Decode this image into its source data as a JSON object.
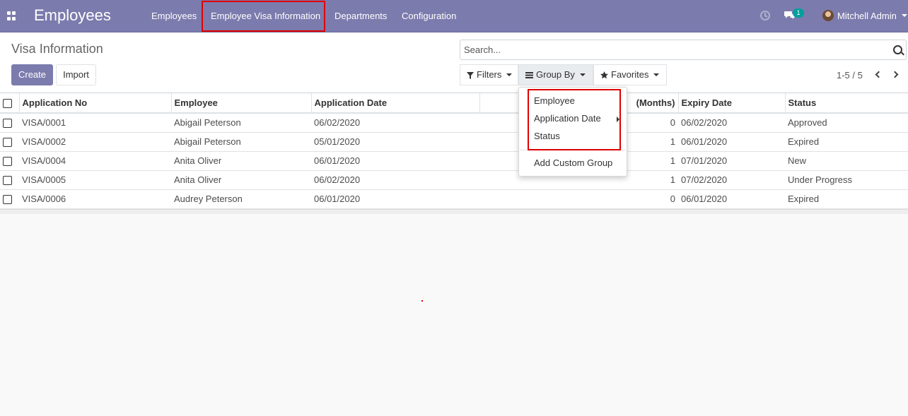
{
  "navbar": {
    "app_title": "Employees",
    "menu": [
      "Employees",
      "Employee Visa Information",
      "Departments",
      "Configuration"
    ],
    "chat_count": "1",
    "user_name": "Mitchell Admin"
  },
  "control_panel": {
    "title": "Visa Information",
    "create_label": "Create",
    "import_label": "Import",
    "search_placeholder": "Search...",
    "filters_label": "Filters",
    "group_by_label": "Group By",
    "favorites_label": "Favorites",
    "pager": "1-5 / 5"
  },
  "table": {
    "columns": [
      "Application No",
      "Employee",
      "Application Date",
      "(Months)",
      "Expiry Date",
      "Status"
    ],
    "rows": [
      {
        "app_no": "VISA/0001",
        "employee": "Abigail Peterson",
        "app_date": "06/02/2020",
        "months": "0",
        "expiry": "06/02/2020",
        "status": "Approved"
      },
      {
        "app_no": "VISA/0002",
        "employee": "Abigail Peterson",
        "app_date": "05/01/2020",
        "months": "1",
        "expiry": "06/01/2020",
        "status": "Expired"
      },
      {
        "app_no": "VISA/0004",
        "employee": "Anita Oliver",
        "app_date": "06/01/2020",
        "months": "1",
        "expiry": "07/01/2020",
        "status": "New"
      },
      {
        "app_no": "VISA/0005",
        "employee": "Anita Oliver",
        "app_date": "06/02/2020",
        "months": "1",
        "expiry": "07/02/2020",
        "status": "Under Progress"
      },
      {
        "app_no": "VISA/0006",
        "employee": "Audrey Peterson",
        "app_date": "06/01/2020",
        "months": "0",
        "expiry": "06/01/2020",
        "status": "Expired"
      }
    ]
  },
  "group_by_menu": {
    "items": [
      "Employee",
      "Application Date",
      "Status"
    ],
    "custom": "Add Custom Group"
  },
  "colors": {
    "brand": "#7c7bad",
    "highlight": "#e00000",
    "badge": "#00a09d"
  }
}
